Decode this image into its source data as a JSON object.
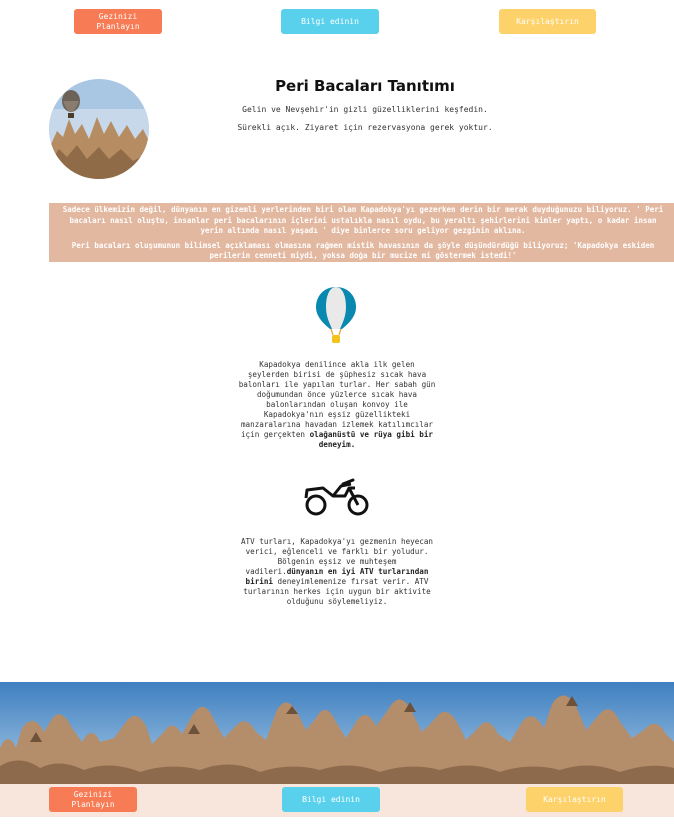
{
  "nav": {
    "plan_label": "Gezinizi\nPlanlayın",
    "info_label": "Bilgi edinin",
    "compare_label": "Karşılaştırın"
  },
  "intro": {
    "title": "Peri Bacaları Tanıtımı",
    "line1": "Gelin ve Nevşehir'in gizli güzelliklerini keşfedin.",
    "line2": "Sürekli açık. Ziyaret için rezervasyona gerek yoktur."
  },
  "banner": {
    "p1": "Sadece ülkemizin değil, dünyanın en gizemli yerlerinden biri olan Kapadokya'yı gezerken derin bir merak duyduğunuzu biliyoruz. ' Peri bacaları nasıl oluştu, insanlar peri bacalarının içlerini ustalıkla nasıl oydu, bu yeraltı şehirlerini kimler yaptı, o kadar insan yerin altında nasıl yaşadı ' diye binlerce soru geliyor gezginin aklına.",
    "p2": "Peri bacaları oluşumunun bilimsel açıklaması olmasına rağmen mistik havasının da şöyle düşündürdüğü biliyoruz; 'Kapadokya eskiden perilerin cenneti miydi, yoksa doğa bir mucize mi göstermek istedi!'"
  },
  "balloon_section": {
    "icon": "hot-air-balloon-icon",
    "text": "Kapadokya denilince akla ilk gelen şeylerden birisi de şüphesiz sıcak hava balonları ile yapılan turlar. Her sabah gün doğumundan önce yüzlerce sıcak hava balonlarından oluşan konvoy ile Kapadokya'nın eşsiz güzellikteki manzaralarına havadan izlemek katılımcılar için gerçekten ",
    "bold": "olağanüstü ve rüya gibi bir deneyim."
  },
  "atv_section": {
    "icon": "motorcycle-icon",
    "text1": "ATV turları, Kapadokya'yı gezmenin heyecan verici, eğlenceli ve farklı bir yoludur. Bölgenin eşsiz ve muhteşem vadileri.",
    "bold": "dünyanın en iyi ATV turlarından birini",
    "text2": " deneyimlemenize fırsat verir. ATV turlarının herkes için uygun bir aktivite olduğunu söylemeliyiz."
  },
  "colors": {
    "orange": "#f77b54",
    "blue": "#5ad1ec",
    "yellow": "#fdd26a",
    "banner": "#e3b8a1",
    "footer": "#f8e6dc"
  }
}
